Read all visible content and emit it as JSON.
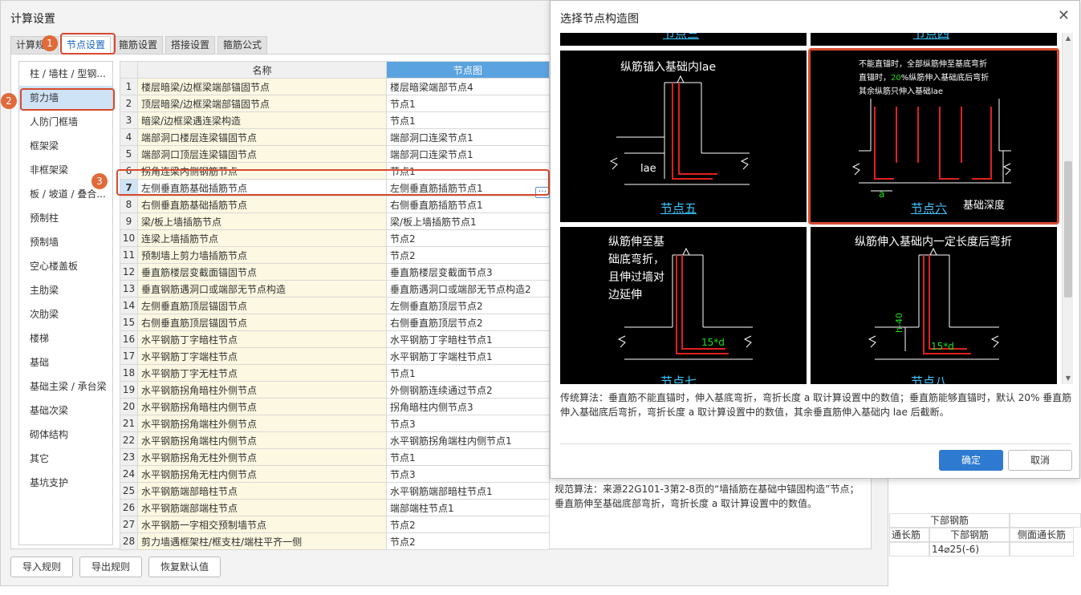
{
  "window": {
    "title": "计算设置"
  },
  "tabs": [
    "计算规",
    "节点设置",
    "箍筋设置",
    "搭接设置",
    "箍筋公式"
  ],
  "badges": [
    "1",
    "2",
    "3"
  ],
  "sidebar": [
    "柱 / 墙柱 / 型钢...",
    "剪力墙",
    "人防门框墙",
    "框架梁",
    "非框架梁",
    "板 / 坡道 / 叠合...",
    "预制柱",
    "预制墙",
    "空心楼盖板",
    "主肋梁",
    "次肋梁",
    "楼梯",
    "基础",
    "基础主梁 / 承台梁",
    "基础次梁",
    "砌体结构",
    "其它",
    "基坑支护"
  ],
  "table": {
    "headers": [
      "名称",
      "节点图"
    ],
    "rows": [
      [
        "1",
        "楼层暗梁/边框梁端部锚固节点",
        "楼层暗梁端部节点4"
      ],
      [
        "2",
        "顶层暗梁/边框梁端部锚固节点",
        "节点1"
      ],
      [
        "3",
        "暗梁/边框梁遇连梁构造",
        "节点1"
      ],
      [
        "4",
        "端部洞口楼层连梁锚固节点",
        "端部洞口连梁节点1"
      ],
      [
        "5",
        "端部洞口顶层连梁锚固节点",
        "端部洞口连梁节点1"
      ],
      [
        "6",
        "拐角连梁内侧钢筋节点",
        "节点1"
      ],
      [
        "7",
        "左侧垂直筋基础插筋节点",
        "左侧垂直筋插筋节点1"
      ],
      [
        "8",
        "右侧垂直筋基础插筋节点",
        "右侧垂直筋插筋节点1"
      ],
      [
        "9",
        "梁/板上墙插筋节点",
        "梁/板上墙插筋节点1"
      ],
      [
        "10",
        "连梁上墙插筋节点",
        "节点2"
      ],
      [
        "11",
        "预制墙上剪力墙插筋节点",
        "节点2"
      ],
      [
        "12",
        "垂直筋楼层变截面锚固节点",
        "垂直筋楼层变截面节点3"
      ],
      [
        "13",
        "垂直钢筋遇洞口或端部无节点构造",
        "垂直筋遇洞口或端部无节点构造2"
      ],
      [
        "14",
        "左侧垂直筋顶层锚固节点",
        "左侧垂直筋顶层节点2"
      ],
      [
        "15",
        "右侧垂直筋顶层锚固节点",
        "右侧垂直筋顶层节点2"
      ],
      [
        "16",
        "水平钢筋丁字暗柱节点",
        "水平钢筋丁字暗柱节点1"
      ],
      [
        "17",
        "水平钢筋丁字端柱节点",
        "水平钢筋丁字端柱节点1"
      ],
      [
        "18",
        "水平钢筋丁字无柱节点",
        "节点1"
      ],
      [
        "19",
        "水平钢筋拐角暗柱外侧节点",
        "外侧钢筋连续通过节点2"
      ],
      [
        "20",
        "水平钢筋拐角暗柱内侧节点",
        "拐角暗柱内侧节点3"
      ],
      [
        "21",
        "水平钢筋拐角端柱外侧节点",
        "节点3"
      ],
      [
        "22",
        "水平钢筋拐角端柱内侧节点",
        "水平钢筋拐角端柱内侧节点1"
      ],
      [
        "23",
        "水平钢筋拐角无柱外侧节点",
        "节点1"
      ],
      [
        "24",
        "水平钢筋拐角无柱内侧节点",
        "节点3"
      ],
      [
        "25",
        "水平钢筋端部暗柱节点",
        "水平钢筋端部暗柱节点1"
      ],
      [
        "26",
        "水平钢筋端部端柱节点",
        "端部端柱节点1"
      ],
      [
        "27",
        "水平钢筋一字相交预制墙节点",
        "节点2"
      ],
      [
        "28",
        "剪力墙遇框架柱/框支柱/端柱平齐一侧",
        "节点2"
      ]
    ],
    "selected_row": 7
  },
  "main_desc": "规范算法：来源22G101-3第2-8页的“墙插筋在基础中锚固构造”节点；垂直筋伸至基础底部弯折，弯折长度 a 取计算设置中的数值。",
  "buttons": [
    "导入规则",
    "导出规则",
    "恢复默认值"
  ],
  "right_grid": {
    "group": "下部钢筋",
    "h1": "通长筋",
    "h2": "下部钢筋",
    "h3": "侧面通长筋",
    "val": "14⌀25(-6)"
  },
  "dialog": {
    "title": "选择节点构造图",
    "top_labels": [
      "节点三",
      "节点四"
    ],
    "nodes": [
      {
        "caption": "节点五",
        "text": [
          "纵筋锚入基础内lae"
        ],
        "dim": "lae"
      },
      {
        "caption": "节点六",
        "text": [
          "不能直锚时，全部纵筋伸至基底弯折",
          "直锚时，",
          "20",
          "%纵筋伸入基础底后弯折",
          "其余纵筋只伸入基础lae"
        ],
        "dim": "a",
        "extra": "基础深度"
      },
      {
        "caption": "节点七",
        "text": [
          "纵筋伸至基",
          "础底弯折，",
          "且伸过墙对",
          "边延伸"
        ],
        "dim": "15*d"
      },
      {
        "caption": "节点八",
        "text": [
          "纵筋伸入基础内一定长度后弯折"
        ],
        "dim": "15*d",
        "dim2": "h-40"
      }
    ],
    "desc": "传统算法：垂直筋不能直锚时，伸入基底弯折，弯折长度 a 取计算设置中的数值；垂直筋能够直锚时，默认 20% 垂直筋伸入基础底后弯折，弯折长度 a 取计算设置中的数值，其余垂直筋伸入基础内 lae 后截断。",
    "ok": "确定",
    "cancel": "取消",
    "close": "✕"
  },
  "colors": {
    "accent": "#2e7ad1",
    "highlight": "#d84a2f",
    "rebar": "#e02020",
    "dim_green": "#18e018",
    "caption_cyan": "#3cc8ff"
  }
}
